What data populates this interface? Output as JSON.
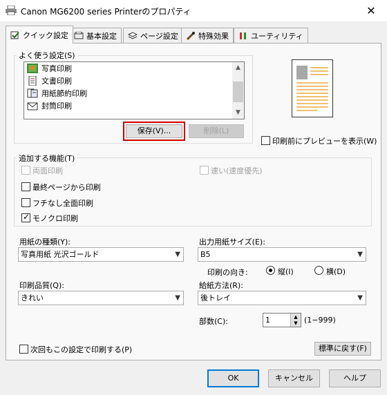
{
  "window": {
    "title": "Canon MG6200 series Printerのプロパティ",
    "close_glyph": "✕"
  },
  "tabs": [
    {
      "label": "クイック設定",
      "icon": "quick-settings-icon",
      "active": true
    },
    {
      "label": "基本設定",
      "icon": "basic-settings-icon"
    },
    {
      "label": "ページ設定",
      "icon": "page-settings-icon"
    },
    {
      "label": "特殊効果",
      "icon": "special-effects-icon"
    },
    {
      "label": "ユーティリティ",
      "icon": "utility-icon"
    }
  ],
  "favorites": {
    "group_label": "よく使う設定(S)",
    "items": [
      {
        "label": "写真印刷",
        "icon": "photo-print-icon"
      },
      {
        "label": "文書印刷",
        "icon": "document-print-icon"
      },
      {
        "label": "用紙節約印刷",
        "icon": "paper-saving-icon"
      },
      {
        "label": "封筒印刷",
        "icon": "envelope-print-icon"
      }
    ],
    "save_label": "保存(V)...",
    "delete_label": "削除(L)"
  },
  "preview": {
    "show_preview_label": "印刷前にプレビューを表示(W)",
    "show_preview_checked": false
  },
  "additional": {
    "group_label": "追加する機能(T)",
    "duplex_label": "両面印刷",
    "fast_label": "速い(速度優先)",
    "last_page_label": "最終ページから印刷",
    "borderless_label": "フチなし全面印刷",
    "mono_label": "モノクロ印刷",
    "mono_checked": true
  },
  "media_type": {
    "label": "用紙の種類(Y):",
    "value": "写真用紙 光沢ゴールド"
  },
  "output_size": {
    "label": "出力用紙サイズ(E):",
    "value": "B5"
  },
  "orientation": {
    "label": "印刷の向き:",
    "portrait_label": "縦(I)",
    "landscape_label": "横(D)",
    "selected": "portrait"
  },
  "quality": {
    "label": "印刷品質(Q):",
    "value": "きれい"
  },
  "paper_source": {
    "label": "給紙方法(R):",
    "value": "後トレイ"
  },
  "copies": {
    "label": "部数(C):",
    "value": "1",
    "range": "(1−999)"
  },
  "always_print_label": "次回もこの設定で印刷する(P)",
  "defaults_label": "標準に戻す(F)",
  "buttons": {
    "ok": "OK",
    "cancel": "キャンセル",
    "help": "ヘルプ"
  },
  "colors": {
    "highlight_box": "#d00000",
    "default_button_border": "#0078d7"
  }
}
